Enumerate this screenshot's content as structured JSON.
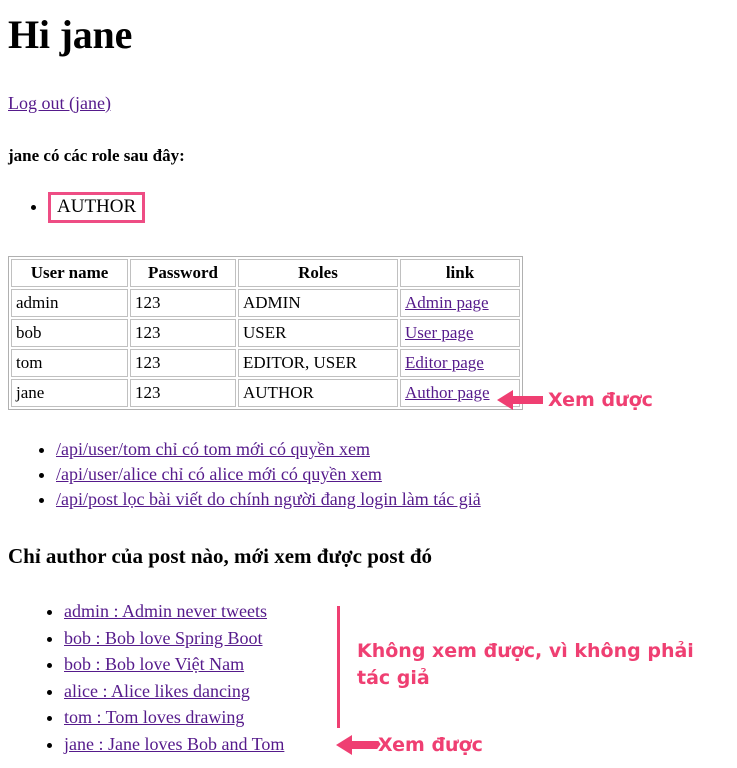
{
  "header": {
    "greeting": "Hi jane",
    "logout_link": "Log out (jane)",
    "role_heading": "jane có các role sau đây:"
  },
  "roles": {
    "items": [
      "AUTHOR"
    ]
  },
  "users_table": {
    "columns": [
      "User name",
      "Password",
      "Roles",
      "link"
    ],
    "rows": [
      {
        "username": "admin",
        "password": "123",
        "roles": "ADMIN",
        "link": "Admin page"
      },
      {
        "username": "bob",
        "password": "123",
        "roles": "USER",
        "link": "User page"
      },
      {
        "username": "tom",
        "password": "123",
        "roles": "EDITOR, USER",
        "link": "Editor page"
      },
      {
        "username": "jane",
        "password": "123",
        "roles": "AUTHOR",
        "link": "Author page"
      }
    ]
  },
  "api_links": [
    "/api/user/tom chỉ có tom mới có quyền xem",
    "/api/user/alice chỉ có alice mới có quyền xem",
    "/api/post lọc bài viết do chính người đang login làm tác giả"
  ],
  "post_section": {
    "heading": "Chỉ author của post nào, mới xem được post đó",
    "items": [
      "admin : Admin never tweets",
      "bob : Bob love Spring Boot",
      "bob : Bob love Việt Nam",
      "alice : Alice likes dancing",
      "tom : Tom loves drawing",
      "jane : Jane loves Bob and Tom"
    ]
  },
  "annotations": {
    "table_note": "Xem được",
    "posts_denied_note": "Không xem được, vì không phải tác giả",
    "posts_allowed_note": "Xem được"
  },
  "colors": {
    "accent_pink": "#ef3f72",
    "box_pink": "#ee4d84",
    "link_purple": "#551a8b"
  }
}
